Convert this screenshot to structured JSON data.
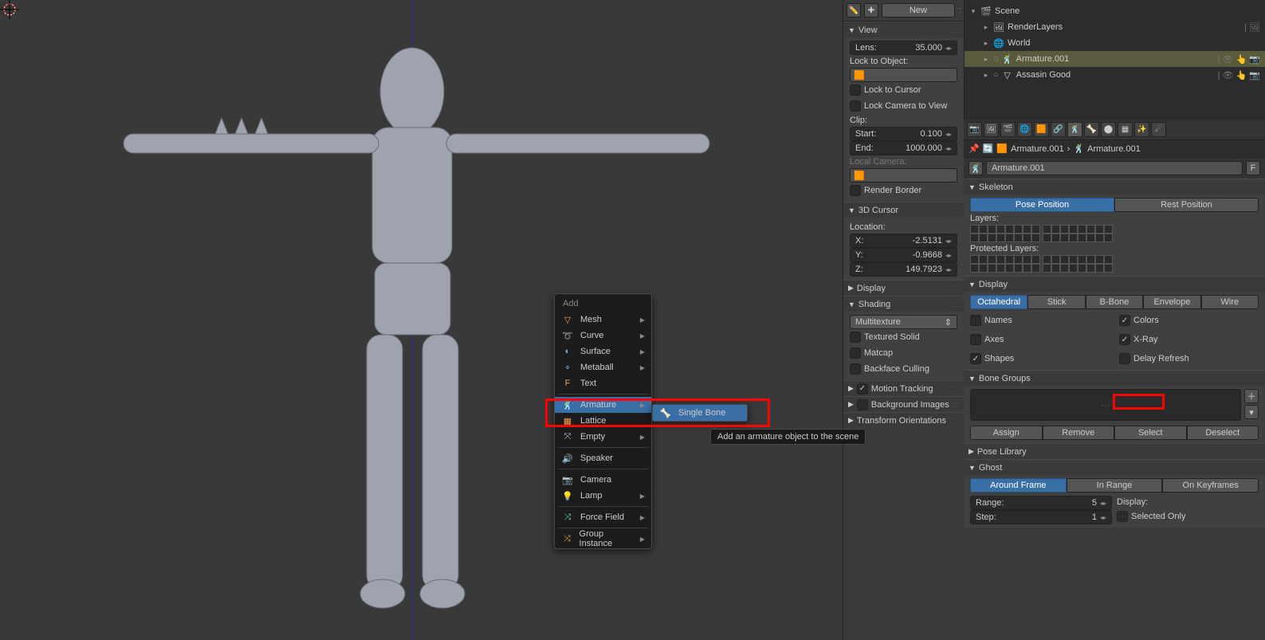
{
  "viewport": {
    "cursor3d": "3d-cursor"
  },
  "n_panel": {
    "new_btn": "New",
    "view": {
      "title": "View",
      "lens_label": "Lens:",
      "lens_value": "35.000",
      "lock_label": "Lock to Object:",
      "lock_cursor": "Lock to Cursor",
      "lock_cam": "Lock Camera to View",
      "clip_label": "Clip:",
      "clip_start_l": "Start:",
      "clip_start_v": "0.100",
      "clip_end_l": "End:",
      "clip_end_v": "1000.000",
      "local_cam": "Local Camera:",
      "render_border": "Render Border"
    },
    "cursor": {
      "title": "3D Cursor",
      "loc": "Location:",
      "x_l": "X:",
      "x_v": "-2.5131",
      "y_l": "Y:",
      "y_v": "-0.9668",
      "z_l": "Z:",
      "z_v": "149.7923"
    },
    "display": {
      "title": "Display"
    },
    "shading": {
      "title": "Shading",
      "mode": "Multitexture",
      "tex_solid": "Textured Solid",
      "matcap": "Matcap",
      "backface": "Backface Culling"
    },
    "motion": {
      "title": "Motion Tracking"
    },
    "bg": {
      "title": "Background Images"
    },
    "xform": {
      "title": "Transform Orientations"
    }
  },
  "outliner": {
    "rows": [
      {
        "name": "Scene",
        "ico": "🎬",
        "tri": "▾"
      },
      {
        "name": "RenderLayers",
        "ico": "🖼",
        "tri": "▸",
        "extra": "🖼"
      },
      {
        "name": "World",
        "ico": "🌐",
        "tri": "▸"
      },
      {
        "name": "Armature.001",
        "ico": "🕺",
        "tri": "▸",
        "sel": true,
        "extras": "👁 👆 📷",
        "dot": "○"
      },
      {
        "name": "Assasin Good",
        "ico": "▽",
        "tri": "▸",
        "extras": "👁 👆 📷",
        "dot": "○"
      }
    ]
  },
  "props": {
    "crumb1": "Armature.001",
    "crumb2": "Armature.001",
    "name_field": "Armature.001",
    "f_btn": "F",
    "skeleton": {
      "title": "Skeleton",
      "pose": "Pose Position",
      "rest": "Rest Position",
      "layers": "Layers:",
      "prot": "Protected Layers:"
    },
    "display": {
      "title": "Display",
      "types": [
        "Octahedral",
        "Stick",
        "B-Bone",
        "Envelope",
        "Wire"
      ],
      "names": "Names",
      "axes": "Axes",
      "shapes": "Shapes",
      "colors": "Colors",
      "xray": "X-Ray",
      "delay": "Delay Refresh"
    },
    "bone_groups": {
      "title": "Bone Groups",
      "assign": "Assign",
      "remove": "Remove",
      "select": "Select",
      "deselect": "Deselect"
    },
    "pose_lib": {
      "title": "Pose Library"
    },
    "ghost": {
      "title": "Ghost",
      "around": "Around Frame",
      "inrange": "In Range",
      "onkey": "On Keyframes",
      "range_l": "Range:",
      "range_v": "5",
      "step_l": "Step:",
      "step_v": "1",
      "disp": "Display:",
      "sel_only": "Selected Only"
    }
  },
  "menu": {
    "header": "Add",
    "items": [
      {
        "ico": "▽",
        "label": "Mesh",
        "sub": true,
        "c": "#f0a050"
      },
      {
        "ico": "➰",
        "label": "Curve",
        "sub": true,
        "c": "#f0a050"
      },
      {
        "ico": "◐",
        "label": "Surface",
        "sub": true,
        "c": "#70b0d0"
      },
      {
        "ico": "⚬",
        "label": "Metaball",
        "sub": true,
        "c": "#70b0d0"
      },
      {
        "ico": "F",
        "label": "Text",
        "sub": false,
        "c": "#f0a050"
      },
      {
        "ico": "🕺",
        "label": "Armature",
        "sub": true,
        "sel": true,
        "c": "#f0a050"
      },
      {
        "ico": "▦",
        "label": "Lattice",
        "sub": false,
        "c": "#f0a050"
      },
      {
        "ico": "⤧",
        "label": "Empty",
        "sub": true,
        "c": "#c0c0c0"
      },
      {
        "ico": "🔊",
        "label": "Speaker",
        "sub": false,
        "c": "#f0a050"
      },
      {
        "ico": "📷",
        "label": "Camera",
        "sub": false,
        "c": "#f0a050"
      },
      {
        "ico": "💡",
        "label": "Lamp",
        "sub": true,
        "c": "#f0a050"
      },
      {
        "ico": "⤨",
        "label": "Force Field",
        "sub": true,
        "c": "#70d0a0"
      },
      {
        "ico": "⤨",
        "label": "Group Instance",
        "sub": true,
        "c": "#f0a050"
      }
    ],
    "submenu": {
      "ico": "🦴",
      "label": "Single Bone"
    },
    "tooltip": "Add an armature object to the scene"
  }
}
